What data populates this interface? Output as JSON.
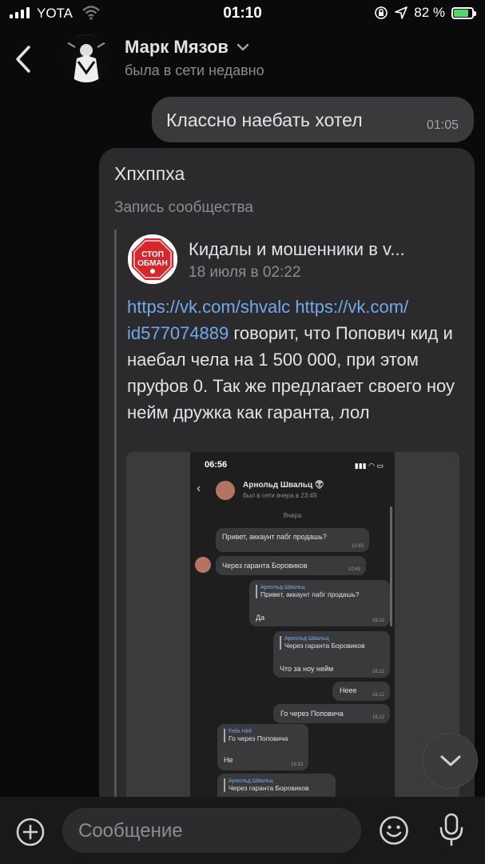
{
  "status": {
    "carrier": "YOTA",
    "time": "01:10",
    "battery": "82 %",
    "battery_level": 0.82
  },
  "header": {
    "name": "Марк Мязов",
    "seen": "была в сети недавно"
  },
  "outgoing": {
    "text": "Классно наебать хотел",
    "time": "01:05"
  },
  "incoming": {
    "text": "Хпхппха",
    "type_label": "Запись сообщества",
    "group_logo_text": [
      "СТОП",
      "ОБМАН"
    ],
    "group_name": "Кидалы и мошенники в v...",
    "date": "18 июля в 02:22",
    "link1": "https://vk.com/shvalc",
    "link2": "https://vk.com/",
    "link3": "id577074889",
    "body": " говорит, что Попович кид и наебал чела на 1 500 000, при этом пруфов 0. Так же предлагает своего ноу нейм дружка как гаранта, лол"
  },
  "screenshot": {
    "time": "06:56",
    "name": "Арнольд Швальц 👽",
    "seen": "был в сети вчера в 23:49",
    "day": "Вчера",
    "messages": [
      {
        "text": "Привет, аккаунт пабг продашь?",
        "time": "10:43"
      },
      {
        "text": "Через гаранта Боровиков",
        "time": "10:43"
      },
      {
        "quote_author": "Арнольд Швальц",
        "quote_text": "Привет, аккаунт пабг продашь?",
        "text": "Да",
        "time": "16:12"
      },
      {
        "quote_author": "Арнольд Швальц",
        "quote_text": "Через гаранта Боровиков",
        "text": "Что за ноу нейм",
        "time": "16:12"
      },
      {
        "text": "Неее",
        "time": "16:12"
      },
      {
        "text": "Го через Поповича",
        "time": "16:12"
      },
      {
        "quote_author": "Felix Heil",
        "quote_text": "Го через Поповича",
        "text": "Не",
        "time": "16:13"
      },
      {
        "quote_author": "Арнольд Швальц",
        "quote_text": "Через гаранта Боровиков",
        "text": "",
        "time": ""
      }
    ]
  },
  "composer": {
    "placeholder": "Сообщение"
  },
  "colors": {
    "link": "#71aaeb",
    "bubble": "#3a3a3c",
    "background": "#0a0a0a"
  }
}
